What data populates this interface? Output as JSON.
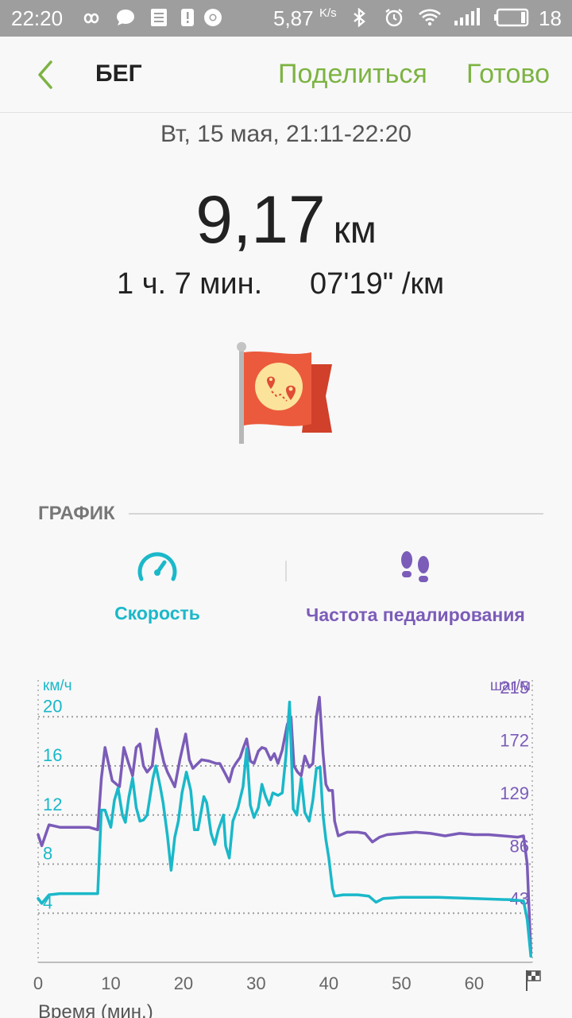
{
  "status_bar": {
    "time": "22:20",
    "net_speed": "5,87",
    "net_unit": "K/s",
    "battery": "18",
    "icons": [
      "infinity-icon",
      "message-icon",
      "notes-icon",
      "alert-icon",
      "chrome-icon",
      "bluetooth-icon",
      "alarm-icon",
      "wifi-icon",
      "signal-icon",
      "battery-icon"
    ]
  },
  "header": {
    "title": "БЕГ",
    "share_label": "Поделиться",
    "done_label": "Готово",
    "back_icon": "chevron-left-icon"
  },
  "workout": {
    "date": "Вт, 15 мая, 21:11-22:20",
    "distance_value": "9,17",
    "distance_unit": "км",
    "duration": "1 ч. 7 мин.",
    "pace": "07'19\" /км",
    "badge_icon": "route-flag-icon"
  },
  "section": {
    "title": "ГРАФИК"
  },
  "tabs": [
    {
      "label": "Скорость",
      "icon": "speedometer-icon",
      "color": "#1ab8c9"
    },
    {
      "label": "Частота педалирования",
      "icon": "footprints-icon",
      "color": "#7b5cb8"
    }
  ],
  "colors": {
    "accent_green": "#7cb342",
    "speed": "#1ab8c9",
    "cadence": "#7b5cb8"
  },
  "chart_data": {
    "type": "line",
    "xlabel": "Время (мин.)",
    "x_ticks": [
      0,
      10,
      20,
      30,
      40,
      50,
      60
    ],
    "xlim": [
      0,
      68
    ],
    "y_left": {
      "unit": "км/ч",
      "ticks": [
        4,
        8,
        12,
        16,
        20
      ],
      "range": [
        0,
        23
      ]
    },
    "y_right": {
      "unit": "шаг/м",
      "ticks": [
        43,
        86,
        129,
        172,
        215
      ],
      "range": [
        0,
        230
      ]
    },
    "grid": true,
    "end_marker_icon": "finish-flag-icon",
    "series": [
      {
        "name": "Скорость",
        "axis": "left",
        "points": [
          [
            0,
            5.2
          ],
          [
            0.5,
            4.8
          ],
          [
            1.5,
            5.5
          ],
          [
            3,
            5.6
          ],
          [
            5,
            5.6
          ],
          [
            7,
            5.6
          ],
          [
            8.2,
            5.6
          ],
          [
            8.7,
            12.4
          ],
          [
            9.2,
            12.4
          ],
          [
            10,
            11.0
          ],
          [
            10.5,
            13.2
          ],
          [
            11,
            14.2
          ],
          [
            11.6,
            12.0
          ],
          [
            12,
            11.4
          ],
          [
            12.5,
            13.5
          ],
          [
            13,
            15.0
          ],
          [
            13.5,
            12.6
          ],
          [
            14,
            11.5
          ],
          [
            14.5,
            11.6
          ],
          [
            15,
            12.0
          ],
          [
            15.8,
            15.0
          ],
          [
            16.2,
            16.0
          ],
          [
            16.8,
            14.3
          ],
          [
            17.2,
            13.0
          ],
          [
            17.8,
            10.3
          ],
          [
            18.3,
            7.5
          ],
          [
            18.8,
            10.2
          ],
          [
            19.3,
            11.5
          ],
          [
            19.8,
            13.8
          ],
          [
            20.4,
            15.5
          ],
          [
            21,
            14.0
          ],
          [
            21.5,
            10.8
          ],
          [
            22,
            10.8
          ],
          [
            22.8,
            13.5
          ],
          [
            23.2,
            13.0
          ],
          [
            23.8,
            10.5
          ],
          [
            24.3,
            9.6
          ],
          [
            24.8,
            10.8
          ],
          [
            25.5,
            12.0
          ],
          [
            25.8,
            9.5
          ],
          [
            26.3,
            8.5
          ],
          [
            26.8,
            11.5
          ],
          [
            27.5,
            12.6
          ],
          [
            28.2,
            14.3
          ],
          [
            28.7,
            17.4
          ],
          [
            29.2,
            12.8
          ],
          [
            29.7,
            11.8
          ],
          [
            30.3,
            12.6
          ],
          [
            30.8,
            14.5
          ],
          [
            31.3,
            13.5
          ],
          [
            31.8,
            12.8
          ],
          [
            32.3,
            13.8
          ],
          [
            33,
            13.6
          ],
          [
            33.6,
            13.8
          ],
          [
            34.1,
            16.8
          ],
          [
            34.6,
            21.2
          ],
          [
            35.1,
            12.5
          ],
          [
            35.6,
            12.0
          ],
          [
            36.2,
            15.0
          ],
          [
            36.7,
            12.2
          ],
          [
            37.3,
            11.5
          ],
          [
            37.8,
            13.2
          ],
          [
            38.3,
            15.8
          ],
          [
            38.8,
            15.9
          ],
          [
            39.2,
            12.0
          ],
          [
            39.6,
            10.0
          ],
          [
            40,
            8.5
          ],
          [
            40.5,
            6.0
          ],
          [
            40.8,
            5.4
          ],
          [
            42,
            5.5
          ],
          [
            44,
            5.5
          ],
          [
            45.5,
            5.4
          ],
          [
            46.5,
            4.9
          ],
          [
            47.5,
            5.2
          ],
          [
            50,
            5.3
          ],
          [
            55,
            5.3
          ],
          [
            60,
            5.2
          ],
          [
            65,
            5.1
          ],
          [
            66.8,
            5.0
          ],
          [
            67.3,
            3.5
          ],
          [
            67.8,
            0.5
          ]
        ]
      },
      {
        "name": "Частота педалирования",
        "axis": "right",
        "points": [
          [
            0,
            104
          ],
          [
            0.5,
            95
          ],
          [
            1.5,
            112
          ],
          [
            3,
            110
          ],
          [
            5,
            110
          ],
          [
            7,
            110
          ],
          [
            8.2,
            108
          ],
          [
            8.7,
            150
          ],
          [
            9.2,
            175
          ],
          [
            10.2,
            148
          ],
          [
            11.2,
            143
          ],
          [
            11.8,
            175
          ],
          [
            12.4,
            163
          ],
          [
            13,
            152
          ],
          [
            13.5,
            175
          ],
          [
            14,
            178
          ],
          [
            14.5,
            160
          ],
          [
            15,
            155
          ],
          [
            15.7,
            160
          ],
          [
            16.3,
            190
          ],
          [
            16.8,
            176
          ],
          [
            17.3,
            163
          ],
          [
            17.8,
            155
          ],
          [
            18.3,
            149
          ],
          [
            18.8,
            143
          ],
          [
            19.5,
            165
          ],
          [
            20.3,
            186
          ],
          [
            20.8,
            165
          ],
          [
            21.3,
            158
          ],
          [
            22.5,
            165
          ],
          [
            23.5,
            164
          ],
          [
            24.5,
            162
          ],
          [
            25,
            162
          ],
          [
            25.8,
            153
          ],
          [
            26.3,
            147
          ],
          [
            26.8,
            158
          ],
          [
            27.2,
            162
          ],
          [
            27.8,
            167
          ],
          [
            28.2,
            174
          ],
          [
            28.7,
            182
          ],
          [
            29.2,
            164
          ],
          [
            29.7,
            162
          ],
          [
            30.3,
            172
          ],
          [
            30.8,
            175
          ],
          [
            31.3,
            174
          ],
          [
            32,
            165
          ],
          [
            32.5,
            170
          ],
          [
            33,
            162
          ],
          [
            33.6,
            173
          ],
          [
            34.3,
            194
          ],
          [
            34.8,
            200
          ],
          [
            35.2,
            160
          ],
          [
            35.7,
            155
          ],
          [
            36.2,
            152
          ],
          [
            36.7,
            168
          ],
          [
            37.3,
            159
          ],
          [
            37.8,
            162
          ],
          [
            38.3,
            200
          ],
          [
            38.7,
            216
          ],
          [
            39.2,
            170
          ],
          [
            39.6,
            145
          ],
          [
            40,
            140
          ],
          [
            40.5,
            140
          ],
          [
            40.8,
            115
          ],
          [
            41.3,
            103
          ],
          [
            42.5,
            106
          ],
          [
            44,
            106
          ],
          [
            45,
            105
          ],
          [
            46,
            98
          ],
          [
            47,
            102
          ],
          [
            48,
            104
          ],
          [
            50,
            105
          ],
          [
            52,
            106
          ],
          [
            54,
            105
          ],
          [
            56,
            103
          ],
          [
            58,
            105
          ],
          [
            60,
            104
          ],
          [
            62,
            104
          ],
          [
            64,
            103
          ],
          [
            66,
            102
          ],
          [
            66.8,
            103
          ],
          [
            67.3,
            80
          ],
          [
            67.8,
            8
          ]
        ]
      }
    ]
  }
}
